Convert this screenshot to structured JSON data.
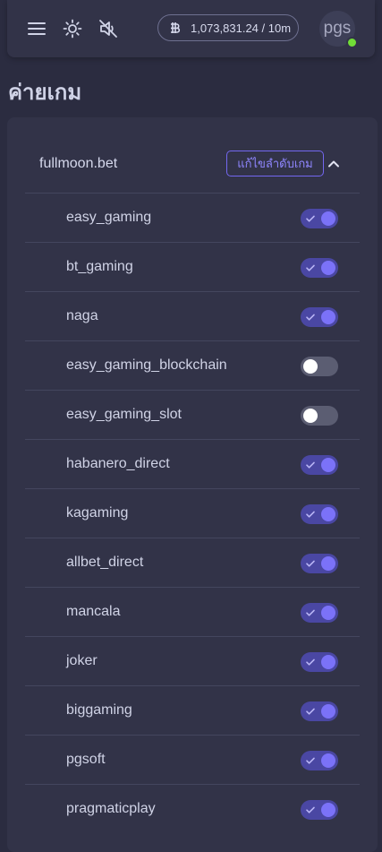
{
  "topbar": {
    "balance": "1,073,831.24 / 10m",
    "avatar_text": "pgs"
  },
  "icons": {
    "menu": "menu-icon",
    "theme": "sun-icon",
    "sound": "volume-mute-icon",
    "currency": "bitcoin-icon",
    "collapse": "chevron-up-icon",
    "toggle_check": "check-icon"
  },
  "page": {
    "title": "ค่ายเกม"
  },
  "card": {
    "site_name": "fullmoon.bet",
    "edit_label": "แก้ไขลำดับเกม"
  },
  "colors": {
    "accent": "#7367f0",
    "online": "#71dd37",
    "background": "#2b2c40",
    "surface": "#323348"
  },
  "providers": [
    {
      "name": "easy_gaming",
      "enabled": true
    },
    {
      "name": "bt_gaming",
      "enabled": true
    },
    {
      "name": "naga",
      "enabled": true
    },
    {
      "name": "easy_gaming_blockchain",
      "enabled": false
    },
    {
      "name": "easy_gaming_slot",
      "enabled": false
    },
    {
      "name": "habanero_direct",
      "enabled": true
    },
    {
      "name": "kagaming",
      "enabled": true
    },
    {
      "name": "allbet_direct",
      "enabled": true
    },
    {
      "name": "mancala",
      "enabled": true
    },
    {
      "name": "joker",
      "enabled": true
    },
    {
      "name": "biggaming",
      "enabled": true
    },
    {
      "name": "pgsoft",
      "enabled": true
    },
    {
      "name": "pragmaticplay",
      "enabled": true
    }
  ]
}
